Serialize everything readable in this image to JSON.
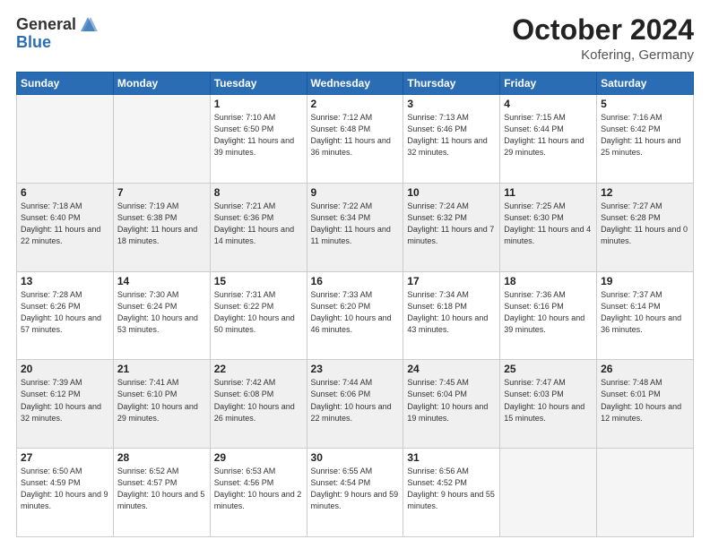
{
  "header": {
    "logo": {
      "general": "General",
      "blue": "Blue"
    },
    "title": "October 2024",
    "subtitle": "Kofering, Germany"
  },
  "weekdays": [
    "Sunday",
    "Monday",
    "Tuesday",
    "Wednesday",
    "Thursday",
    "Friday",
    "Saturday"
  ],
  "weeks": [
    [
      {
        "day": "",
        "empty": true
      },
      {
        "day": "",
        "empty": true
      },
      {
        "day": "1",
        "sunrise": "Sunrise: 7:10 AM",
        "sunset": "Sunset: 6:50 PM",
        "daylight": "Daylight: 11 hours and 39 minutes."
      },
      {
        "day": "2",
        "sunrise": "Sunrise: 7:12 AM",
        "sunset": "Sunset: 6:48 PM",
        "daylight": "Daylight: 11 hours and 36 minutes."
      },
      {
        "day": "3",
        "sunrise": "Sunrise: 7:13 AM",
        "sunset": "Sunset: 6:46 PM",
        "daylight": "Daylight: 11 hours and 32 minutes."
      },
      {
        "day": "4",
        "sunrise": "Sunrise: 7:15 AM",
        "sunset": "Sunset: 6:44 PM",
        "daylight": "Daylight: 11 hours and 29 minutes."
      },
      {
        "day": "5",
        "sunrise": "Sunrise: 7:16 AM",
        "sunset": "Sunset: 6:42 PM",
        "daylight": "Daylight: 11 hours and 25 minutes."
      }
    ],
    [
      {
        "day": "6",
        "sunrise": "Sunrise: 7:18 AM",
        "sunset": "Sunset: 6:40 PM",
        "daylight": "Daylight: 11 hours and 22 minutes."
      },
      {
        "day": "7",
        "sunrise": "Sunrise: 7:19 AM",
        "sunset": "Sunset: 6:38 PM",
        "daylight": "Daylight: 11 hours and 18 minutes."
      },
      {
        "day": "8",
        "sunrise": "Sunrise: 7:21 AM",
        "sunset": "Sunset: 6:36 PM",
        "daylight": "Daylight: 11 hours and 14 minutes."
      },
      {
        "day": "9",
        "sunrise": "Sunrise: 7:22 AM",
        "sunset": "Sunset: 6:34 PM",
        "daylight": "Daylight: 11 hours and 11 minutes."
      },
      {
        "day": "10",
        "sunrise": "Sunrise: 7:24 AM",
        "sunset": "Sunset: 6:32 PM",
        "daylight": "Daylight: 11 hours and 7 minutes."
      },
      {
        "day": "11",
        "sunrise": "Sunrise: 7:25 AM",
        "sunset": "Sunset: 6:30 PM",
        "daylight": "Daylight: 11 hours and 4 minutes."
      },
      {
        "day": "12",
        "sunrise": "Sunrise: 7:27 AM",
        "sunset": "Sunset: 6:28 PM",
        "daylight": "Daylight: 11 hours and 0 minutes."
      }
    ],
    [
      {
        "day": "13",
        "sunrise": "Sunrise: 7:28 AM",
        "sunset": "Sunset: 6:26 PM",
        "daylight": "Daylight: 10 hours and 57 minutes."
      },
      {
        "day": "14",
        "sunrise": "Sunrise: 7:30 AM",
        "sunset": "Sunset: 6:24 PM",
        "daylight": "Daylight: 10 hours and 53 minutes."
      },
      {
        "day": "15",
        "sunrise": "Sunrise: 7:31 AM",
        "sunset": "Sunset: 6:22 PM",
        "daylight": "Daylight: 10 hours and 50 minutes."
      },
      {
        "day": "16",
        "sunrise": "Sunrise: 7:33 AM",
        "sunset": "Sunset: 6:20 PM",
        "daylight": "Daylight: 10 hours and 46 minutes."
      },
      {
        "day": "17",
        "sunrise": "Sunrise: 7:34 AM",
        "sunset": "Sunset: 6:18 PM",
        "daylight": "Daylight: 10 hours and 43 minutes."
      },
      {
        "day": "18",
        "sunrise": "Sunrise: 7:36 AM",
        "sunset": "Sunset: 6:16 PM",
        "daylight": "Daylight: 10 hours and 39 minutes."
      },
      {
        "day": "19",
        "sunrise": "Sunrise: 7:37 AM",
        "sunset": "Sunset: 6:14 PM",
        "daylight": "Daylight: 10 hours and 36 minutes."
      }
    ],
    [
      {
        "day": "20",
        "sunrise": "Sunrise: 7:39 AM",
        "sunset": "Sunset: 6:12 PM",
        "daylight": "Daylight: 10 hours and 32 minutes."
      },
      {
        "day": "21",
        "sunrise": "Sunrise: 7:41 AM",
        "sunset": "Sunset: 6:10 PM",
        "daylight": "Daylight: 10 hours and 29 minutes."
      },
      {
        "day": "22",
        "sunrise": "Sunrise: 7:42 AM",
        "sunset": "Sunset: 6:08 PM",
        "daylight": "Daylight: 10 hours and 26 minutes."
      },
      {
        "day": "23",
        "sunrise": "Sunrise: 7:44 AM",
        "sunset": "Sunset: 6:06 PM",
        "daylight": "Daylight: 10 hours and 22 minutes."
      },
      {
        "day": "24",
        "sunrise": "Sunrise: 7:45 AM",
        "sunset": "Sunset: 6:04 PM",
        "daylight": "Daylight: 10 hours and 19 minutes."
      },
      {
        "day": "25",
        "sunrise": "Sunrise: 7:47 AM",
        "sunset": "Sunset: 6:03 PM",
        "daylight": "Daylight: 10 hours and 15 minutes."
      },
      {
        "day": "26",
        "sunrise": "Sunrise: 7:48 AM",
        "sunset": "Sunset: 6:01 PM",
        "daylight": "Daylight: 10 hours and 12 minutes."
      }
    ],
    [
      {
        "day": "27",
        "sunrise": "Sunrise: 6:50 AM",
        "sunset": "Sunset: 4:59 PM",
        "daylight": "Daylight: 10 hours and 9 minutes."
      },
      {
        "day": "28",
        "sunrise": "Sunrise: 6:52 AM",
        "sunset": "Sunset: 4:57 PM",
        "daylight": "Daylight: 10 hours and 5 minutes."
      },
      {
        "day": "29",
        "sunrise": "Sunrise: 6:53 AM",
        "sunset": "Sunset: 4:56 PM",
        "daylight": "Daylight: 10 hours and 2 minutes."
      },
      {
        "day": "30",
        "sunrise": "Sunrise: 6:55 AM",
        "sunset": "Sunset: 4:54 PM",
        "daylight": "Daylight: 9 hours and 59 minutes."
      },
      {
        "day": "31",
        "sunrise": "Sunrise: 6:56 AM",
        "sunset": "Sunset: 4:52 PM",
        "daylight": "Daylight: 9 hours and 55 minutes."
      },
      {
        "day": "",
        "empty": true
      },
      {
        "day": "",
        "empty": true
      }
    ]
  ]
}
